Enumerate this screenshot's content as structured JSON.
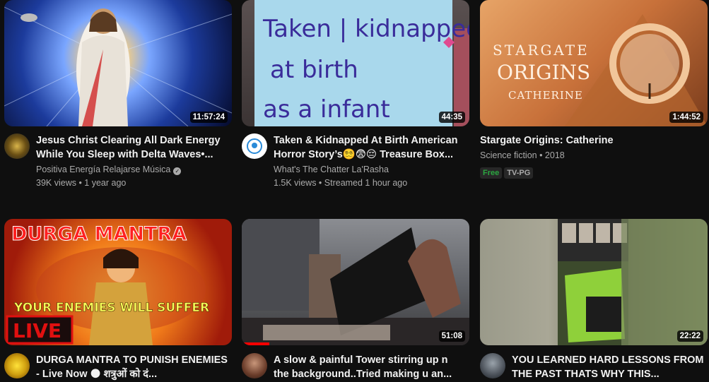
{
  "videos": [
    {
      "title": "Jesus Christ Clearing All Dark Energy While You Sleep with Delta Waves•...",
      "channel": "Positiva Energía Relajarse Música",
      "verified": true,
      "stats": "39K views • 1 year ago",
      "duration": "11:57:24"
    },
    {
      "title": "Taken & Kidnapped At Birth American Horror Story’s😵‍💫😨😔 Treasure Box...",
      "channel": "What's The Chatter La'Rasha",
      "stats": "1.5K views • Streamed 1 hour ago",
      "duration": "44:35",
      "thumb_text": [
        "Taken | kidnapped",
        "at birth",
        "as a infant"
      ]
    },
    {
      "title": "Stargate Origins: Catherine",
      "channel": "Science fiction • 2018",
      "duration": "1:44:52",
      "badges": [
        "Free",
        "TV-PG"
      ],
      "thumb_text": [
        "STARGATE",
        "ORIGINS",
        "CATHERINE"
      ]
    },
    {
      "title": "DURGA MANTRA TO PUNISH ENEMIES - Live Now 🌑 शत्रुओं को दं...",
      "thumb_text": [
        "DURGA MANTRA",
        "YOUR ENEMIES WILL SUFFER",
        "LIVE"
      ]
    },
    {
      "title": "A slow & painful Tower stirring up n the background..Tried making u an...",
      "duration": "51:08",
      "progress": 0.12
    },
    {
      "title": "YOU LEARNED HARD LESSONS FROM THE PAST THATS WHY THIS...",
      "duration": "22:22"
    }
  ],
  "colors": {
    "background": "#0f0f0f",
    "text": "#f1f1f1",
    "muted": "#aaaaaa",
    "free_badge": "#2ba640",
    "progress": "#ff0000"
  }
}
